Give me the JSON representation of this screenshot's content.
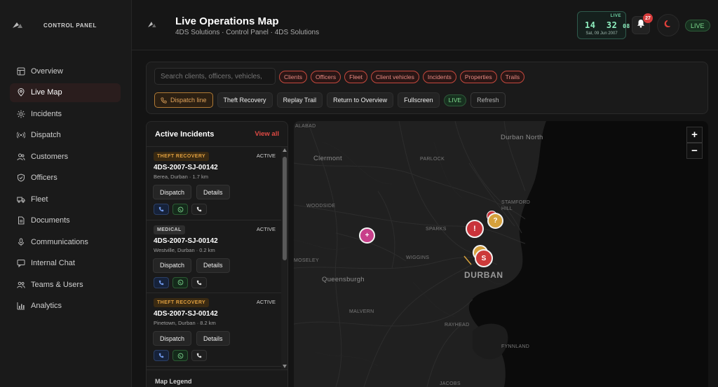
{
  "sidebar": {
    "brand_label": "CONTROL PANEL",
    "items": [
      {
        "label": "Overview",
        "icon": "layout-icon"
      },
      {
        "label": "Live Map",
        "icon": "map-pin-icon",
        "active": true
      },
      {
        "label": "Incidents",
        "icon": "sun-icon"
      },
      {
        "label": "Dispatch",
        "icon": "radio-icon"
      },
      {
        "label": "Customers",
        "icon": "users-icon"
      },
      {
        "label": "Officers",
        "icon": "shield-icon"
      },
      {
        "label": "Fleet",
        "icon": "truck-icon"
      },
      {
        "label": "Documents",
        "icon": "file-icon"
      },
      {
        "label": "Communications",
        "icon": "mic-icon"
      },
      {
        "label": "Internal Chat",
        "icon": "chat-icon"
      },
      {
        "label": "Teams & Users",
        "icon": "team-icon"
      },
      {
        "label": "Analytics",
        "icon": "chart-icon"
      }
    ]
  },
  "header": {
    "title": "Live Operations Map",
    "subtitle": "4DS Solutions · Control Panel · 4DS Solutions",
    "clock": {
      "live": "LIVE",
      "hh": "14",
      "mm": "32",
      "ss": "08",
      "date": "Sat, 09 Jun 2007"
    },
    "notifications": "27",
    "live_label": "LIVE"
  },
  "filters": {
    "search_placeholder": "Search clients, officers, vehicles,",
    "chips": [
      "Clients",
      "Officers",
      "Fleet",
      "Client vehicles",
      "Incidents",
      "Properties",
      "Trails"
    ],
    "actions": {
      "dispatch_line": "Dispatch line",
      "theft_recovery": "Theft Recovery",
      "replay_trail": "Replay Trail",
      "return_overview": "Return to Overview",
      "fullscreen": "Fullscreen",
      "live": "LIVE",
      "refresh": "Refresh"
    }
  },
  "incidents": {
    "title": "Active Incidents",
    "view_all": "View all",
    "legend_title": "Map Legend",
    "dispatch_label": "Dispatch",
    "details_label": "Details",
    "items": [
      {
        "tag": "THEFT RECOVERY",
        "type": "theft",
        "status": "ACTIVE",
        "ref": "4DS-2007-SJ-00142",
        "location": "Berea, Durban · 1.7 km"
      },
      {
        "tag": "MEDICAL",
        "type": "medical",
        "status": "ACTIVE",
        "ref": "4DS-2007-SJ-00142",
        "location": "Westville, Durban · 0.2 km"
      },
      {
        "tag": "THEFT RECOVERY",
        "type": "theft",
        "status": "ACTIVE",
        "ref": "4DS-2007-SJ-00142",
        "location": "Pinetown, Durban · 8.2 km"
      }
    ]
  },
  "map": {
    "labels": [
      {
        "text": "ALABAD"
      },
      {
        "text": "Clermont"
      },
      {
        "text": "PARLOCK"
      },
      {
        "text": "Durban North"
      },
      {
        "text": "WOODSIDE"
      },
      {
        "text": "STAMFORD HILL"
      },
      {
        "text": "SPARKS"
      },
      {
        "text": "WIGGINS"
      },
      {
        "text": "MOSELEY"
      },
      {
        "text": "Queensburgh"
      },
      {
        "text": "DURBAN"
      },
      {
        "text": "MALVERN"
      },
      {
        "text": "RAYHEAD"
      },
      {
        "text": "FYNNLAND"
      },
      {
        "text": "JACOBS"
      }
    ],
    "zoom_in": "+",
    "zoom_out": "−",
    "markers": [
      {
        "glyph": "+",
        "kind": "medical",
        "color": "#c83f8a"
      },
      {
        "glyph": "!",
        "kind": "alert",
        "color": "#c9333a"
      },
      {
        "glyph": "?",
        "kind": "unknown",
        "color": "#d6a13c"
      },
      {
        "glyph": "S",
        "kind": "sos",
        "color": "#cc3a3a"
      }
    ]
  }
}
